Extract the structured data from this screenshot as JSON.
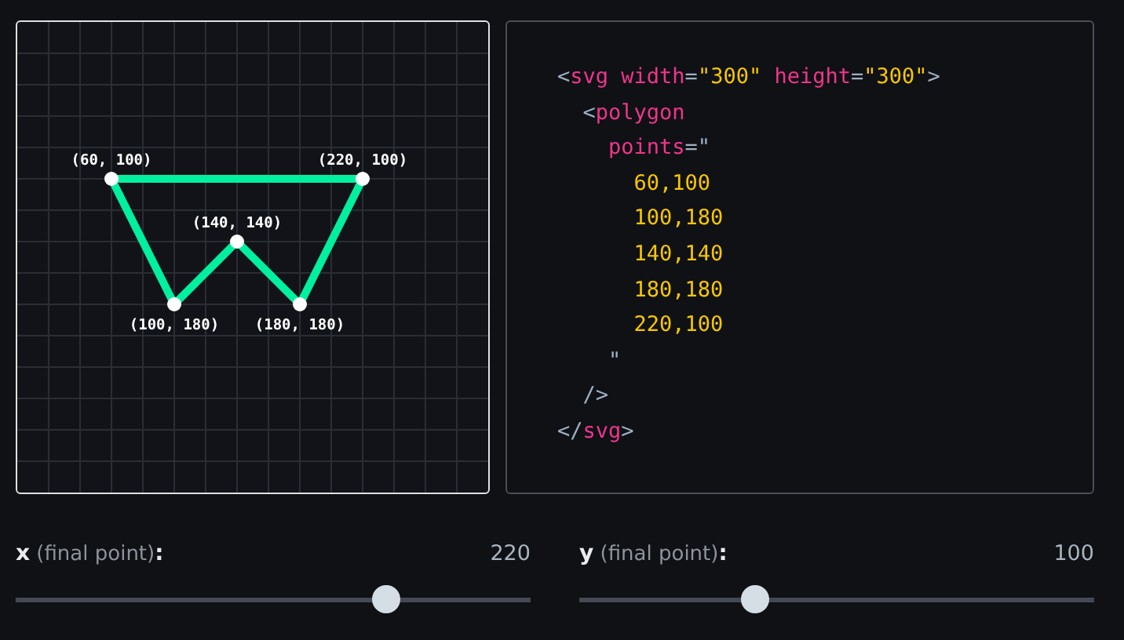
{
  "canvas": {
    "points": [
      {
        "label": "(60, 100)"
      },
      {
        "label": "(100, 180)"
      },
      {
        "label": "(140, 140)"
      },
      {
        "label": "(180, 180)"
      },
      {
        "label": "(220, 100)"
      }
    ]
  },
  "code": [
    {
      "tokens": [
        {
          "kind": "punct",
          "text": "<"
        },
        {
          "kind": "tag",
          "text": "svg"
        },
        {
          "kind": "attr",
          "text": "width"
        },
        {
          "kind": "punct",
          "text": "="
        },
        {
          "kind": "string",
          "text": "\"300\""
        },
        {
          "kind": "attr",
          "text": "height"
        },
        {
          "kind": "punct",
          "text": "="
        },
        {
          "kind": "string",
          "text": "\"300\""
        },
        {
          "kind": "punct",
          "text": ">"
        }
      ],
      "children": [
        {
          "tokens": [
            {
              "kind": "punct",
              "text": "<"
            },
            {
              "kind": "tag",
              "text": "polygon"
            }
          ],
          "children": [
            {
              "tokens": [
                {
                  "kind": "attr",
                  "text": "points"
                },
                {
                  "kind": "punct",
                  "text": "=\""
                }
              ],
              "children": [
                {
                  "tokens": [
                    {
                      "kind": "string",
                      "text": "60,100"
                    }
                  ]
                },
                {
                  "tokens": [
                    {
                      "kind": "string",
                      "text": "100,180"
                    }
                  ]
                },
                {
                  "tokens": [
                    {
                      "kind": "string",
                      "text": "140,140"
                    }
                  ]
                },
                {
                  "tokens": [
                    {
                      "kind": "string",
                      "text": "180,180"
                    }
                  ]
                },
                {
                  "tokens": [
                    {
                      "kind": "string",
                      "text": "220,100"
                    }
                  ]
                }
              ]
            },
            {
              "tokens": [
                {
                  "kind": "punct",
                  "text": "\""
                }
              ]
            }
          ]
        },
        {
          "tokens": [
            {
              "kind": "punct",
              "text": "/>"
            }
          ]
        }
      ]
    },
    {
      "tokens": [
        {
          "kind": "punct",
          "text": "</"
        },
        {
          "kind": "tag",
          "text": "svg"
        },
        {
          "kind": "punct",
          "text": ">"
        }
      ]
    }
  ],
  "sliders": [
    {
      "label": "**x** (final point)**:**",
      "value": "220",
      "level": 0.72
    },
    {
      "label": "**y** (final point)**:**",
      "value": "100",
      "level": 0.34
    }
  ]
}
